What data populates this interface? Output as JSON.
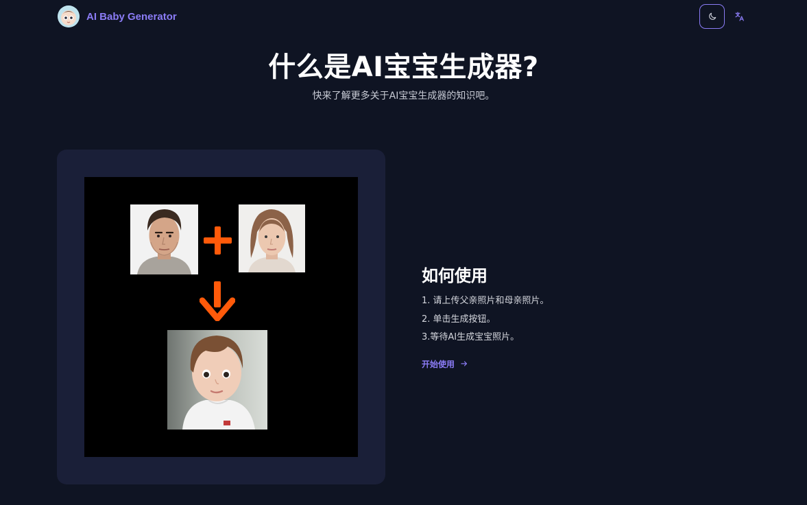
{
  "header": {
    "brand_name": "AI Baby Generator",
    "logo_icon": "baby-face-icon",
    "theme_icon": "moon-icon",
    "language_icon": "translate-icon"
  },
  "hero": {
    "title": "什么是AI宝宝生成器?",
    "subtitle": "快来了解更多关于AI宝宝生成器的知识吧。"
  },
  "illustration": {
    "father_photo": "father-face-photo",
    "mother_photo": "mother-face-photo",
    "baby_photo": "baby-photo",
    "plus_icon": "plus-icon",
    "arrow_icon": "arrow-down-icon",
    "accent_color": "#ff5a0a"
  },
  "howto": {
    "title": "如何使用",
    "steps": [
      "1. 请上传父亲照片和母亲照片。",
      "2. 单击生成按钮。",
      "3.等待AI生成宝宝照片。"
    ],
    "cta_label": "开始使用",
    "cta_icon": "arrow-right-icon"
  },
  "colors": {
    "background": "#0f1423",
    "card": "#1a1f38",
    "accent": "#8b7cf6"
  }
}
